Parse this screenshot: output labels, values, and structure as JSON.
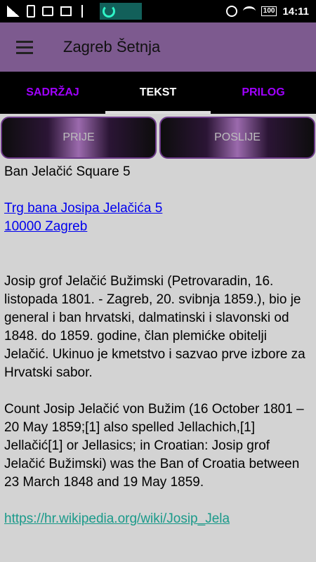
{
  "status_bar": {
    "time": "14:11",
    "battery": "100",
    "icons_left": [
      "signal-icon",
      "sim-icon",
      "image-icon",
      "mail-icon",
      "usb-icon",
      "app-notification-icon"
    ],
    "icons_right": [
      "alarm-icon",
      "wifi-icon",
      "battery-icon"
    ]
  },
  "app_bar": {
    "title": "Zagreb Šetnja",
    "menu_icon": "hamburger-menu-icon",
    "color": "#7d5a8f"
  },
  "tabs": [
    {
      "label": "SADRŽAJ",
      "active": false
    },
    {
      "label": "TEKST",
      "active": true
    },
    {
      "label": "PRILOG",
      "active": false
    }
  ],
  "nav": {
    "prev_label": "PRIJE",
    "next_label": "POSLIJE"
  },
  "content": {
    "heading": "Ban Jelačić Square 5",
    "address_line1": "Trg bana Josipa Jelačića 5",
    "address_line2": "10000 Zagreb",
    "paragraph_hr": "Josip grof Jelačić Bužimski (Petrovaradin, 16. listopada 1801. - Zagreb, 20. svibnja 1859.), bio je general i ban hrvatski, dalmatinski i slavonski od 1848. do 1859. godine, član plemićke obitelji Jelačić. Ukinuo je kmetstvo i sazvao prve izbore za Hrvatski sabor.",
    "paragraph_en": "Count Josip Jelačić von Bužim (16 October 1801 – 20 May 1859;[1] also spelled Jellachich,[1] Jellačić[1] or Jellasics; in Croatian: Josip grof Jelačić Bužimski) was the Ban of Croatia between 23 March 1848 and 19 May 1859.",
    "wiki_link": "https://hr.wikipedia.org/wiki/Josip_Jela"
  },
  "colors": {
    "tab_inactive": "#a000ff",
    "tab_active": "#ffffff",
    "link": "#0000ee",
    "wiki_link": "#1a9a8a",
    "background": "#d3d3d3"
  }
}
